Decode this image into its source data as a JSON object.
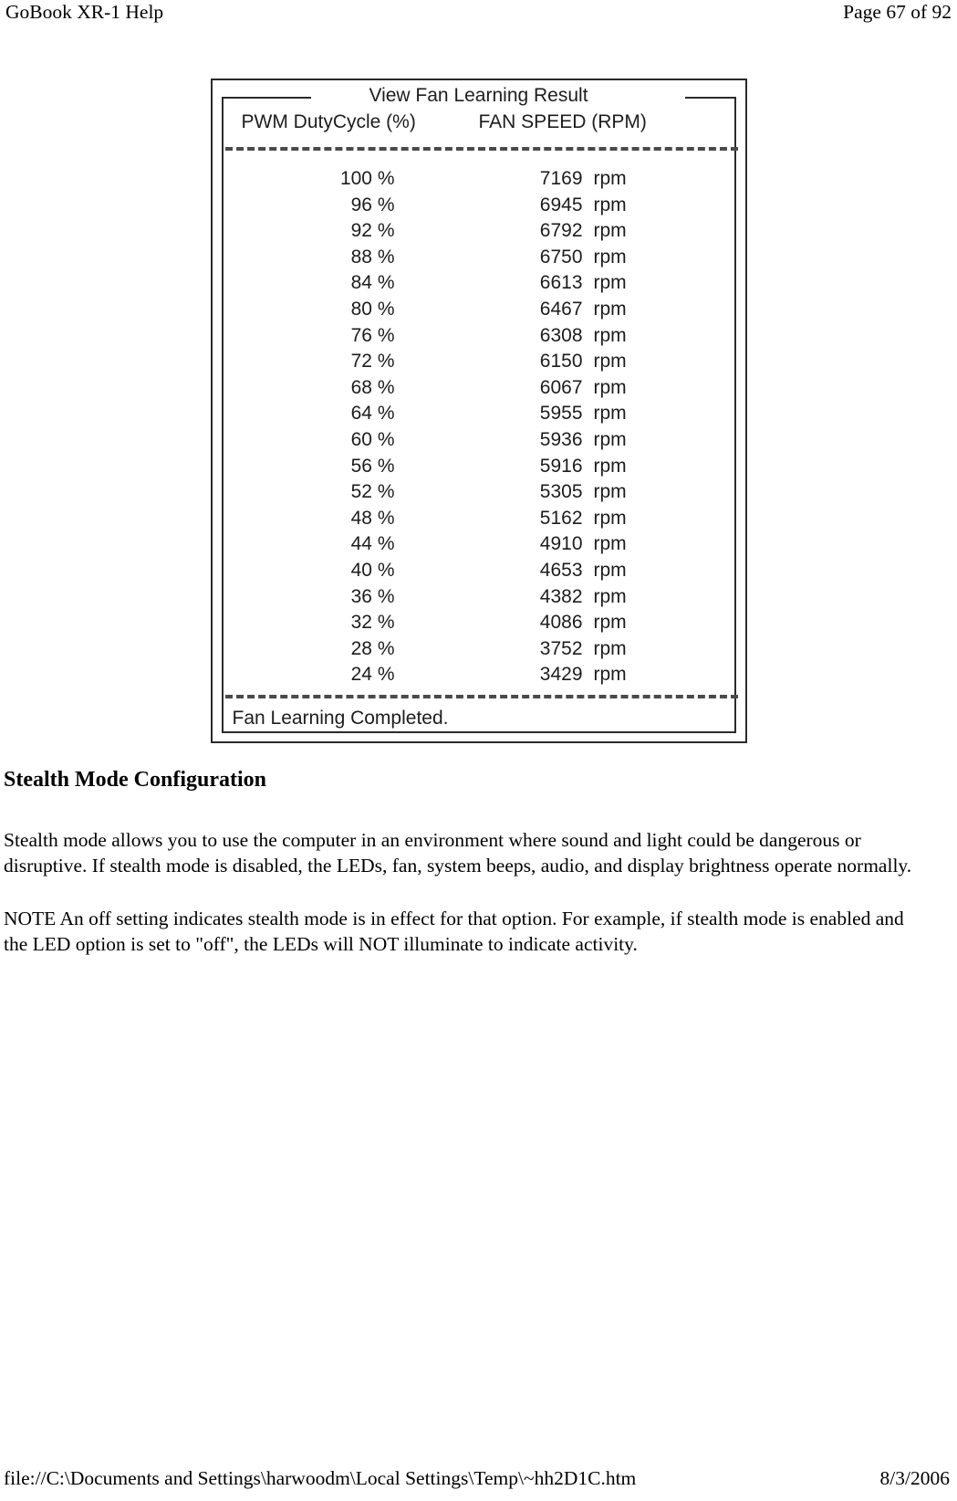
{
  "header": {
    "title": "GoBook XR-1 Help",
    "page_indicator": "Page 67 of 92"
  },
  "figure": {
    "groupbox_title": "View Fan Learning Result",
    "columns": {
      "pwm": "PWM DutyCycle (%)",
      "rpm": "FAN SPEED (RPM)"
    },
    "unit": "rpm",
    "status": "Fan Learning Completed.",
    "rows": [
      {
        "duty": "100 %",
        "rpm": "7169"
      },
      {
        "duty": "96 %",
        "rpm": "6945"
      },
      {
        "duty": "92 %",
        "rpm": "6792"
      },
      {
        "duty": "88 %",
        "rpm": "6750"
      },
      {
        "duty": "84 %",
        "rpm": "6613"
      },
      {
        "duty": "80 %",
        "rpm": "6467"
      },
      {
        "duty": "76 %",
        "rpm": "6308"
      },
      {
        "duty": "72 %",
        "rpm": "6150"
      },
      {
        "duty": "68 %",
        "rpm": "6067"
      },
      {
        "duty": "64 %",
        "rpm": "5955"
      },
      {
        "duty": "60 %",
        "rpm": "5936"
      },
      {
        "duty": "56 %",
        "rpm": "5916"
      },
      {
        "duty": "52 %",
        "rpm": "5305"
      },
      {
        "duty": "48 %",
        "rpm": "5162"
      },
      {
        "duty": "44 %",
        "rpm": "4910"
      },
      {
        "duty": "40 %",
        "rpm": "4653"
      },
      {
        "duty": "36 %",
        "rpm": "4382"
      },
      {
        "duty": "32 %",
        "rpm": "4086"
      },
      {
        "duty": "28 %",
        "rpm": "3752"
      },
      {
        "duty": "24 %",
        "rpm": "3429"
      }
    ]
  },
  "content": {
    "heading": "Stealth Mode Configuration",
    "paragraph_1": "Stealth mode allows you to use the computer in an environment where sound and light could be dangerous or disruptive. If stealth mode is disabled, the LEDs, fan, system beeps, audio, and display brightness operate normally.",
    "paragraph_note": "NOTE  An off setting indicates stealth mode is in effect for that option. For example, if stealth mode is enabled and the LED option is set to \"off\", the LEDs will NOT illuminate to indicate activity."
  },
  "footer": {
    "file_path": "file://C:\\Documents and Settings\\harwoodm\\Local Settings\\Temp\\~hh2D1C.htm",
    "date": "8/3/2006"
  },
  "chart_data": {
    "type": "table",
    "title": "View Fan Learning Result",
    "columns": [
      "PWM DutyCycle (%)",
      "FAN SPEED (RPM)"
    ],
    "x": [
      100,
      96,
      92,
      88,
      84,
      80,
      76,
      72,
      68,
      64,
      60,
      56,
      52,
      48,
      44,
      40,
      36,
      32,
      28,
      24
    ],
    "values": [
      7169,
      6945,
      6792,
      6750,
      6613,
      6467,
      6308,
      6150,
      6067,
      5955,
      5936,
      5916,
      5305,
      5162,
      4910,
      4653,
      4382,
      4086,
      3752,
      3429
    ],
    "xlabel": "PWM DutyCycle (%)",
    "ylabel": "FAN SPEED (RPM)",
    "unit": "rpm",
    "status": "Fan Learning Completed."
  }
}
